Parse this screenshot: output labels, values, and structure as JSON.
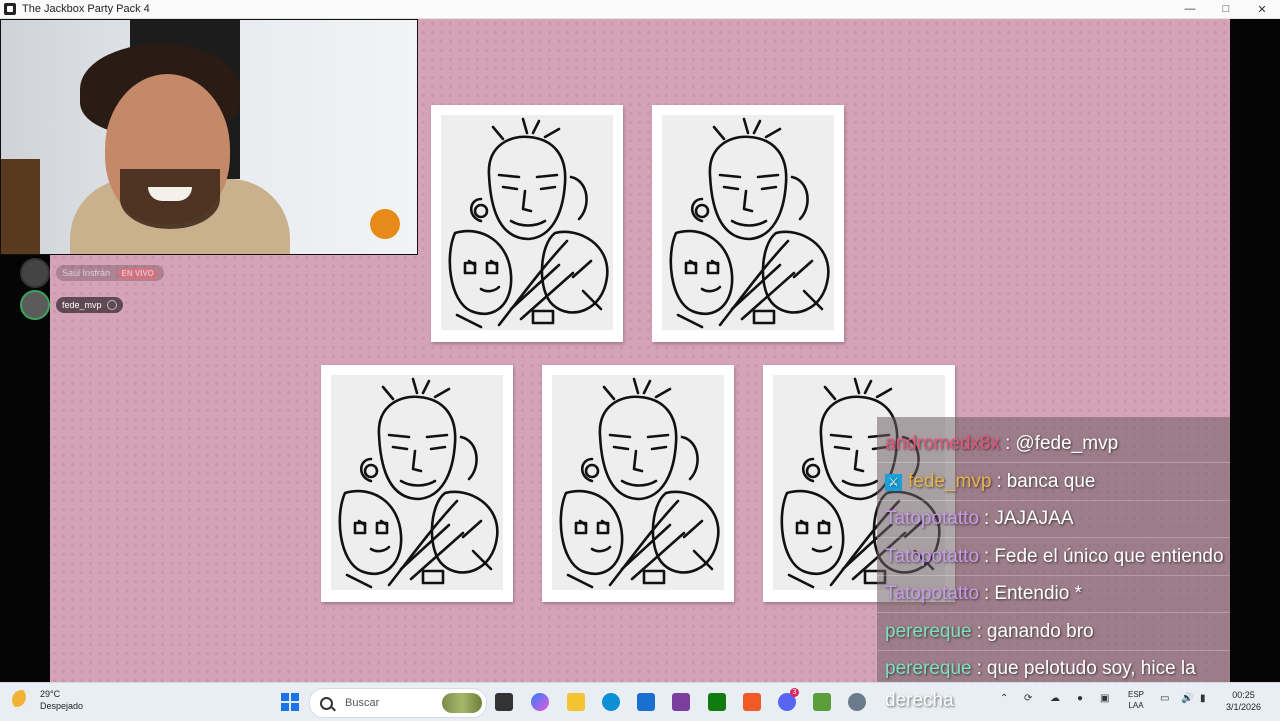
{
  "window": {
    "title": "The Jackbox Party Pack 4"
  },
  "voice": {
    "users": [
      {
        "name": "Saúl Insfrán",
        "badge": "EN VIVO"
      },
      {
        "name": "fede_mvp"
      }
    ]
  },
  "chat": {
    "messages": [
      {
        "user": "andromedx8x",
        "color": "#e8547a",
        "text": "@fede_mvp"
      },
      {
        "user": "fede_mvp",
        "color": "#e7b54c",
        "text": "banca que",
        "badge": "sword-icon"
      },
      {
        "user": "Tatopotatto",
        "color": "#c99ae8",
        "text": "JAJAJAA"
      },
      {
        "user": "Tatopotatto",
        "color": "#c99ae8",
        "text": "Fede el único que entiendo"
      },
      {
        "user": "Tatopotatto",
        "color": "#c99ae8",
        "text": "Entendio *"
      },
      {
        "user": "perereque",
        "color": "#7fe0c0",
        "text": "ganando bro"
      },
      {
        "user": "perereque",
        "color": "#7fe0c0",
        "text": "que pelotudo soy, hice la"
      }
    ],
    "wrap": "derecha"
  },
  "taskbar": {
    "weather": {
      "temp": "29°C",
      "desc": "Despejado"
    },
    "search_placeholder": "Buscar",
    "lang": {
      "line1": "ESP",
      "line2": "LAA"
    },
    "time": "00:25",
    "date": "3/1/2026",
    "discord_badge": "3"
  }
}
